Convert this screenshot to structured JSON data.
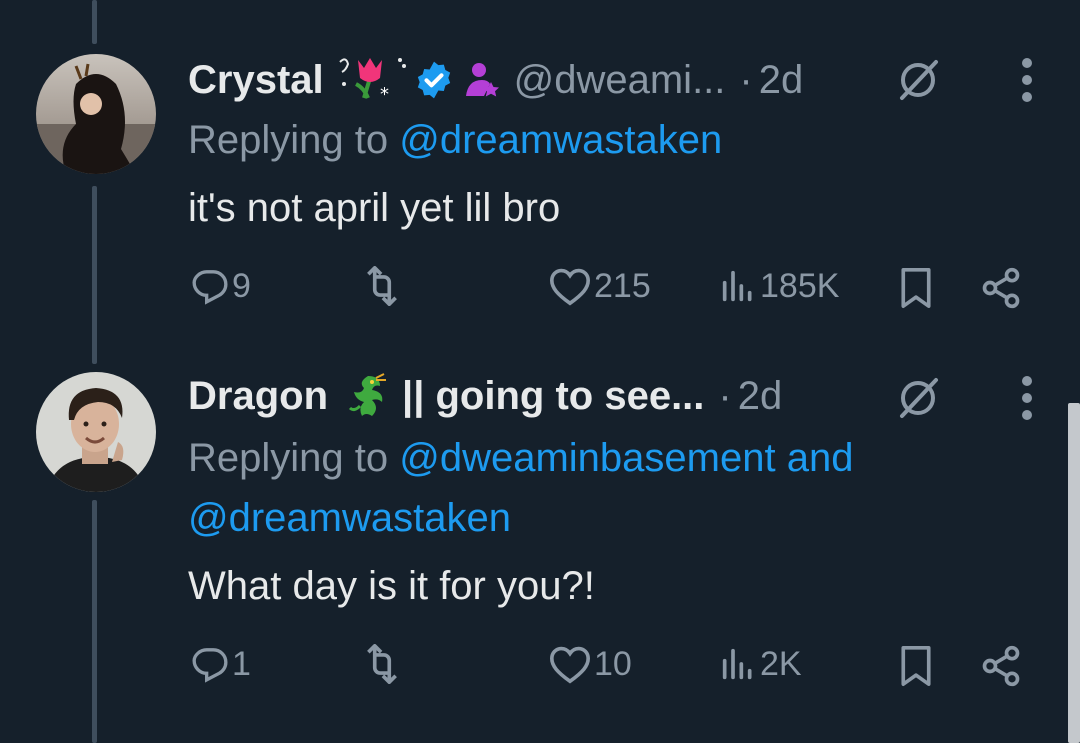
{
  "tweets": [
    {
      "name": "Crystal",
      "handle": "@dweami...",
      "separator": "·",
      "time": "2d",
      "replying_prefix": "Replying to ",
      "replying_mentions": "@dreamwastaken",
      "replying_mentions_line2": "",
      "text": "it's not april yet lil bro",
      "replies": "9",
      "retweets": "",
      "likes": "215",
      "views": "185K",
      "emojis": [
        "tulip-sparkle-icon",
        "verified-badge-icon",
        "user-star-icon"
      ]
    },
    {
      "name": "Dragon",
      "display_suffix": "|| going to see...",
      "separator": "·",
      "time": "2d",
      "replying_prefix": "Replying to ",
      "replying_mentions": "@dweaminbasement and",
      "replying_mentions_line2": "@dreamwastaken",
      "text": "What day is it for you?!",
      "replies": "1",
      "retweets": "",
      "likes": "10",
      "views": "2K",
      "emojis": [
        "dragon-icon"
      ]
    }
  ],
  "colors": {
    "background": "#15202b",
    "text": "#e7e9ea",
    "muted": "#8b98a5",
    "accent": "#1d9bf0"
  }
}
